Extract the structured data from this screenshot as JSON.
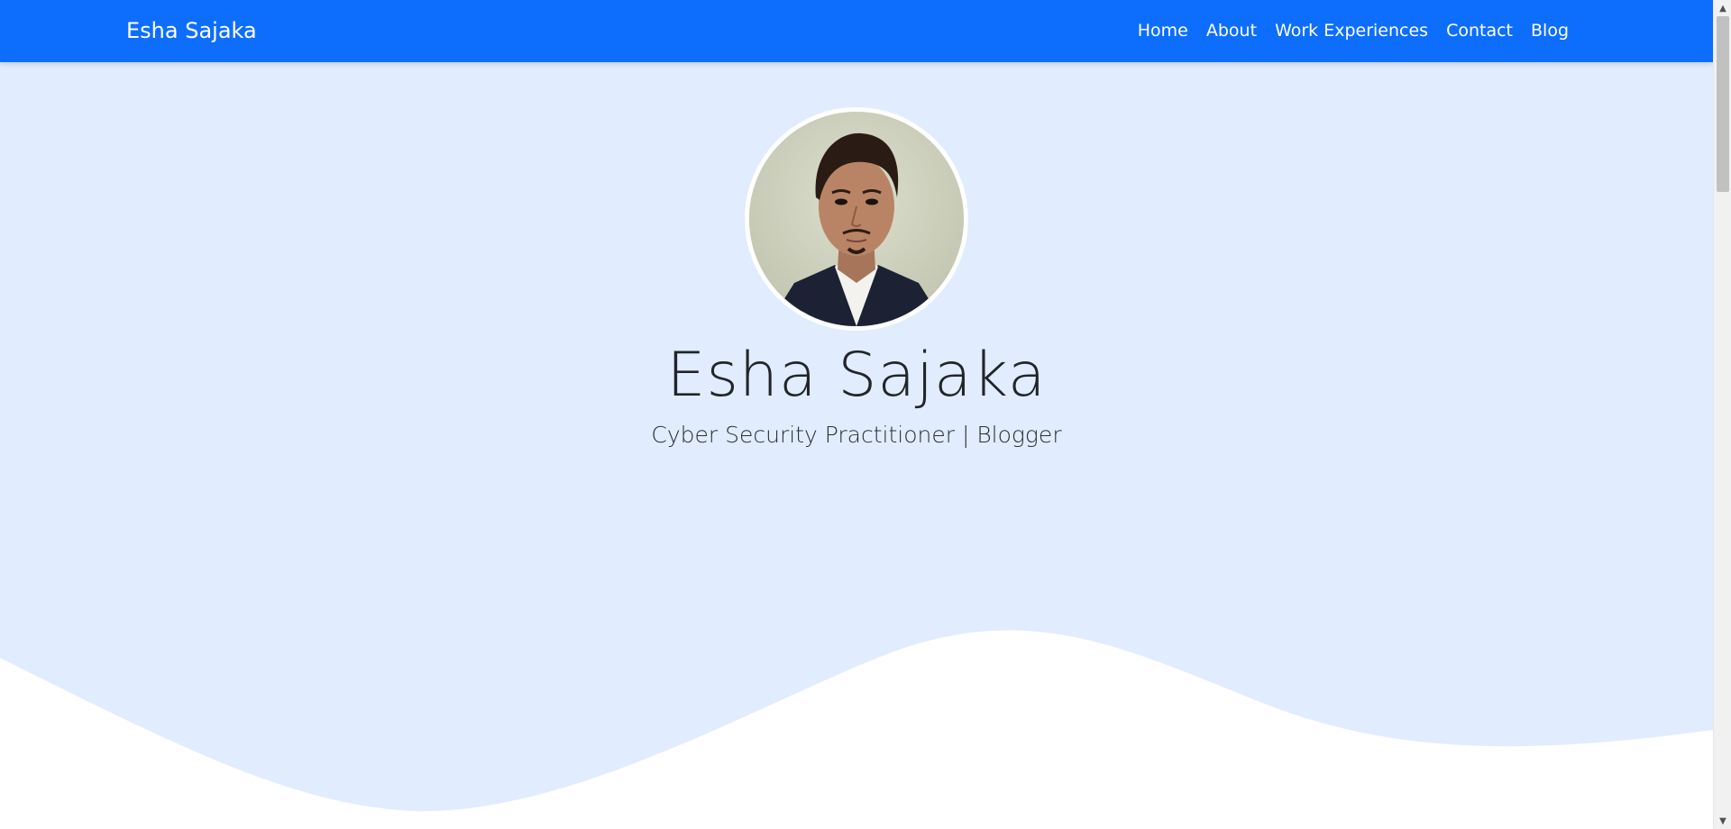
{
  "navbar": {
    "brand": "Esha Sajaka",
    "links": [
      {
        "label": "Home"
      },
      {
        "label": "About"
      },
      {
        "label": "Work Experiences"
      },
      {
        "label": "Contact"
      },
      {
        "label": "Blog"
      }
    ],
    "color": "#0d6efd"
  },
  "hero": {
    "name": "Esha Sajaka",
    "tagline": "Cyber Security Practitioner | Blogger",
    "avatar_icon": "profile-photo",
    "background": "#e1ecfe"
  },
  "scrollbar": {
    "up_icon": "scroll-up-arrow",
    "down_icon": "scroll-down-arrow"
  }
}
